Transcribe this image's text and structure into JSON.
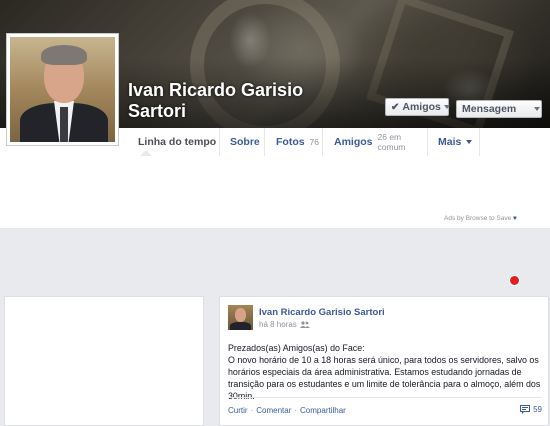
{
  "profile": {
    "name": "Ivan Ricardo Garisio Sartori",
    "friends_button": "Amigos",
    "message_button": "Mensagem"
  },
  "nav": {
    "tabs": [
      {
        "label": "Linha do tempo",
        "count": ""
      },
      {
        "label": "Sobre",
        "count": ""
      },
      {
        "label": "Fotos",
        "count": "76"
      },
      {
        "label": "Amigos",
        "count": "26 em comum"
      },
      {
        "label": "Mais",
        "count": ""
      }
    ]
  },
  "ads": {
    "text": "Ads by Browse to Save"
  },
  "post": {
    "author": "Ivan Ricardo Garisio Sartori",
    "time": "há 8 horas",
    "body_lines": [
      "Prezados(as) Amigos(as) do Face:",
      "O novo horário de 10 a 18 horas será único, para todos os servidores, salvo os horários especiais da área administrativa. Estamos estudando jornadas de transição para os estudantes e um limite de tolerância para o almoço, além dos 30min."
    ],
    "actions": [
      "Curtir",
      "Comentar",
      "Compartilhar"
    ],
    "comment_count": "59"
  },
  "colors": {
    "link": "#3b5998",
    "gray_bg": "#e9eaed",
    "notification": "#e02020"
  }
}
